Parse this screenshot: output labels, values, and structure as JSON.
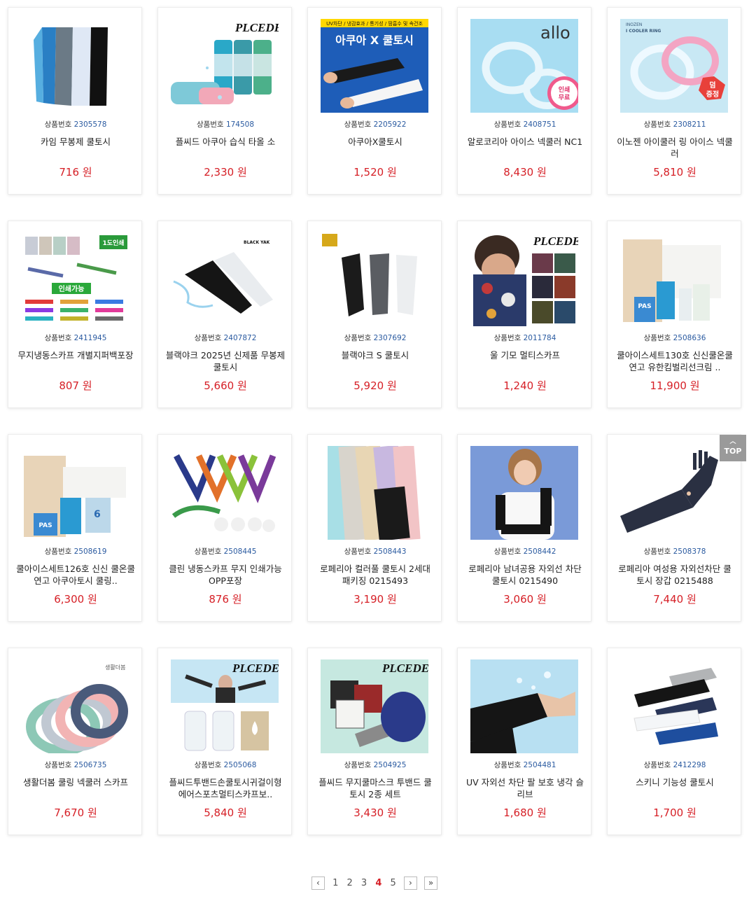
{
  "code_label": "상품번호",
  "currency": "원",
  "colors": {
    "price": "#d61f26",
    "code_num": "#2a5aa0",
    "top_button": "#9a9a9a"
  },
  "products": [
    {
      "code": "2305578",
      "name": "카임 무봉제 쿨토시",
      "price": "716",
      "icon": "arm-sleeves-colors-image"
    },
    {
      "code": "174508",
      "name": "플씨드 아쿠아 습식 타올 소",
      "price": "2,330",
      "icon": "cool-towel-image",
      "brand": "PLCEDE"
    },
    {
      "code": "2205922",
      "name": "아쿠아X쿨토시",
      "price": "1,520",
      "icon": "aqua-x-sleeve-image",
      "banner_top": "UV차단 / 냉감효과 / 통기성 / 땀흡수 및 속건조",
      "banner_title": "아쿠아 X 쿨토시"
    },
    {
      "code": "2408751",
      "name": "알로코리아 아이스 넥쿨러 NC1",
      "price": "8,430",
      "icon": "ice-neck-cooler-image",
      "brand": "allo",
      "badge": "인쇄 무료"
    },
    {
      "code": "2308211",
      "name": "이노젠 아이쿨러 링 아이스 넥쿨러",
      "price": "5,810",
      "icon": "cooler-ring-image",
      "brand": "INOZEN I COOLER RING",
      "badge": "덤 증정"
    },
    {
      "code": "2411945",
      "name": "무지냉동스카프 개별지퍼백포장",
      "price": "807",
      "icon": "frozen-scarf-image",
      "badge": "1도인쇄",
      "tag": "인쇄가능"
    },
    {
      "code": "2407872",
      "name": "블랙야크 2025년 신제품 무봉제 쿨토시",
      "price": "5,660",
      "icon": "blackyak-sleeve-image",
      "brand": "BLACK YAK"
    },
    {
      "code": "2307692",
      "name": "블랙야크 S 쿨토시",
      "price": "5,920",
      "icon": "blackyak-s-sleeve-image"
    },
    {
      "code": "2011784",
      "name": "울 기모 멀티스카프",
      "price": "1,240",
      "icon": "multi-scarf-image",
      "brand": "PLCEDE"
    },
    {
      "code": "2508636",
      "name": "쿨아이스세트130호 신신쿨온쿨연고 유한킴벌리선크림 ..",
      "price": "11,900",
      "icon": "cool-ice-set-130-image"
    },
    {
      "code": "2508619",
      "name": "쿨아이스세트126호 신신 쿨온쿨연고 아쿠아토시 쿨링..",
      "price": "6,300",
      "icon": "cool-ice-set-126-image"
    },
    {
      "code": "2508445",
      "name": "클린 냉동스카프 무지 인쇄가능 OPP포장",
      "price": "876",
      "icon": "clean-frozen-scarf-image"
    },
    {
      "code": "2508443",
      "name": "로페리아 컬러풀 쿨토시 2세대 패키징 0215493",
      "price": "3,190",
      "icon": "colorful-sleeves-image"
    },
    {
      "code": "2508442",
      "name": "로페리아 남녀공용 자외선 차단 쿨토시 0215490",
      "price": "3,060",
      "icon": "unisex-uv-sleeve-image"
    },
    {
      "code": "2508378",
      "name": "로페리아 여성용 자외선차단 쿨토시 장갑 0215488",
      "price": "7,440",
      "icon": "glove-sleeve-image"
    },
    {
      "code": "2506735",
      "name": "생활더봄 쿨링 넥쿨러 스카프",
      "price": "7,670",
      "icon": "cooling-neck-tube-image",
      "brand": "생활더봄"
    },
    {
      "code": "2505068",
      "name": "플씨드투밴드손쿨토시귀걸이형에어스포츠멀티스카프보..",
      "price": "5,840",
      "icon": "two-band-set-image",
      "brand": "PLCEDE"
    },
    {
      "code": "2504925",
      "name": "플씨드 무지쿨마스크 투밴드 쿨토시 2종 세트",
      "price": "3,430",
      "icon": "cool-mask-set-image",
      "brand": "PLCEDE"
    },
    {
      "code": "2504481",
      "name": "UV 자외선 차단 팔 보호 냉각 슬리브",
      "price": "1,680",
      "icon": "uv-arm-sleeve-image"
    },
    {
      "code": "2412298",
      "name": "스키니 기능성 쿨토시",
      "price": "1,700",
      "icon": "skinny-sleeves-image"
    }
  ],
  "top_button": {
    "label": "TOP",
    "icon": "chevron-up-icon"
  },
  "pagination": {
    "prev_icon": "chevron-left-icon",
    "pages": [
      "1",
      "2",
      "3",
      "4",
      "5"
    ],
    "current": "4",
    "next_icon": "chevron-right-icon",
    "last_icon": "double-chevron-right-icon"
  }
}
